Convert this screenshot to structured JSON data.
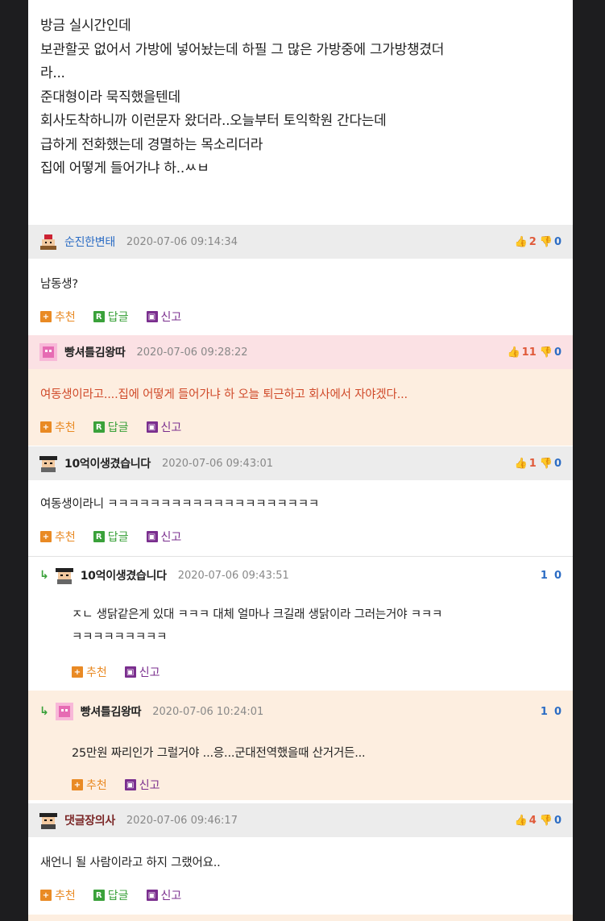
{
  "post": {
    "lines": [
      "방금 실시간인데",
      "보관할곳 없어서 가방에 넣어놨는데 하필 그 많은 가방중에 그가방챙겼더",
      "라...",
      "준대형이라 묵직했을텐데",
      "회사도착하니까 이런문자 왔더라..오늘부터 토익학원 간다는데",
      "급하게 전화했는데 경멸하는 목소리더라",
      "집에 어떻게 들어가냐 하..ㅆㅂ"
    ]
  },
  "actions": {
    "recommend": "추천",
    "reply": "답글",
    "report": "신고",
    "recommend_icon": "+",
    "reply_icon": "R",
    "report_icon": "▣"
  },
  "comments": [
    {
      "author": "순진한변태",
      "date": "2020-07-06 09:14:34",
      "up": "2",
      "down": "0",
      "text": "남동생?"
    },
    {
      "author": "빵셔틀김왕따",
      "date": "2020-07-06 09:28:22",
      "up": "11",
      "down": "0",
      "text": "여동생이라고....집에 어떻게 들어가냐 하 오늘 퇴근하고 회사에서 자야겠다..."
    },
    {
      "author": "10억이생겼습니다",
      "date": "2020-07-06 09:43:01",
      "up": "1",
      "down": "0",
      "text": "여동생이라니 ㅋㅋㅋㅋㅋㅋㅋㅋㅋㅋㅋㅋㅋㅋㅋㅋㅋㅋㅋㅋ"
    },
    {
      "author": "10억이생겼습니다",
      "date": "2020-07-06 09:43:51",
      "up": "1",
      "down": "0",
      "text_line1": "ㅈㄴ 생닭같은게 있대 ㅋㅋㅋ 대체 얼마나 크길래 생닭이라 그러는거야 ㅋㅋㅋ",
      "text_line2": "ㅋㅋㅋㅋㅋㅋㅋㅋㅋ"
    },
    {
      "author": "빵셔틀김왕따",
      "date": "2020-07-06 10:24:01",
      "up": "1",
      "down": "0",
      "text": "25만원 짜리인가 그럴거야 ...응...군대전역했을때 산거거든..."
    },
    {
      "author": "댓글장의사",
      "date": "2020-07-06 09:46:17",
      "up": "4",
      "down": "0",
      "text": "새언니 될 사람이라고 하지 그랬어요.."
    }
  ],
  "colors": {
    "accent_red": "#d04a2a",
    "link_blue": "#2b6cc4",
    "header_gray": "#ececec",
    "header_pink": "#fbe1e4",
    "peach": "#fdeee0"
  }
}
